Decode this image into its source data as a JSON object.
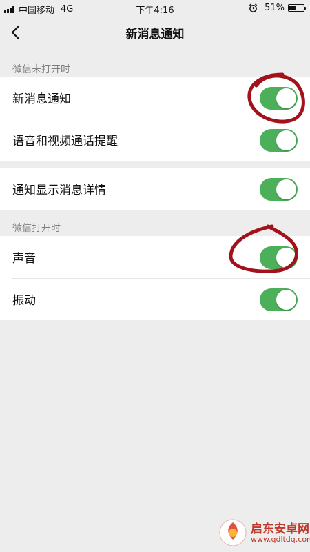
{
  "status_bar": {
    "carrier": "中国移动",
    "network": "4G",
    "time": "下午4:16",
    "battery_text": "51%",
    "battery_level": 0.51
  },
  "nav": {
    "title": "新消息通知"
  },
  "sections": [
    {
      "header": "微信未打开时",
      "rows": [
        {
          "label": "新消息通知",
          "on": true
        },
        {
          "label": "语音和视频通话提醒",
          "on": true
        }
      ]
    },
    {
      "header": "",
      "rows": [
        {
          "label": "通知显示消息详情",
          "on": true
        }
      ]
    },
    {
      "header": "微信打开时",
      "rows": [
        {
          "label": "声音",
          "on": true
        },
        {
          "label": "振动",
          "on": true
        }
      ]
    }
  ],
  "colors": {
    "toggle_on": "#4CAF5A",
    "annotation": "#A3121B",
    "background": "#EDEDED"
  },
  "watermark": {
    "name": "启东安卓网",
    "url": "www.qdltdq.com"
  }
}
